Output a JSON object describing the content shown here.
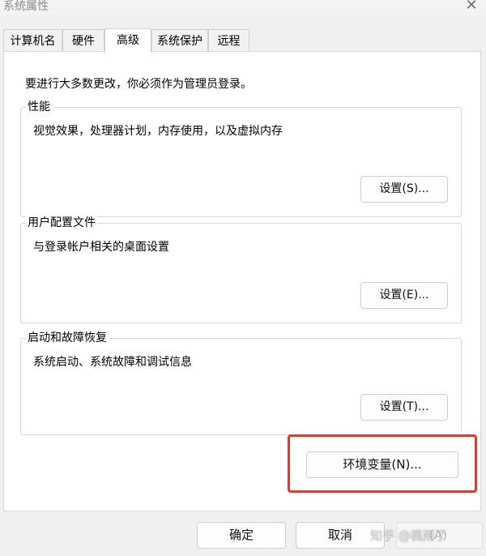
{
  "window": {
    "title": "系统属性",
    "close_icon": "close-icon",
    "close_glyph": "✕"
  },
  "tabs": [
    {
      "label": "计算机名",
      "active": false
    },
    {
      "label": "硬件",
      "active": false
    },
    {
      "label": "高级",
      "active": true
    },
    {
      "label": "系统保护",
      "active": false
    },
    {
      "label": "远程",
      "active": false
    }
  ],
  "panel": {
    "intro": "要进行大多数更改，你必须作为管理员登录。",
    "performance": {
      "title": "性能",
      "description": "视觉效果，处理器计划，内存使用，以及虚拟内存",
      "button": "设置(S)..."
    },
    "user_profiles": {
      "title": "用户配置文件",
      "description": "与登录帐户相关的桌面设置",
      "button": "设置(E)..."
    },
    "startup_recovery": {
      "title": "启动和故障恢复",
      "description": "系统启动、系统故障和调试信息",
      "button": "设置(T)..."
    },
    "env_button": "环境变量(N)..."
  },
  "footer": {
    "ok": "确定",
    "cancel": "取消",
    "apply": "(A)"
  },
  "watermark": {
    "text": "知乎 @楓雨了"
  },
  "colors": {
    "highlight": "#de3b33",
    "panel_bg": "#ffffff",
    "window_bg": "#f0f0f0"
  }
}
